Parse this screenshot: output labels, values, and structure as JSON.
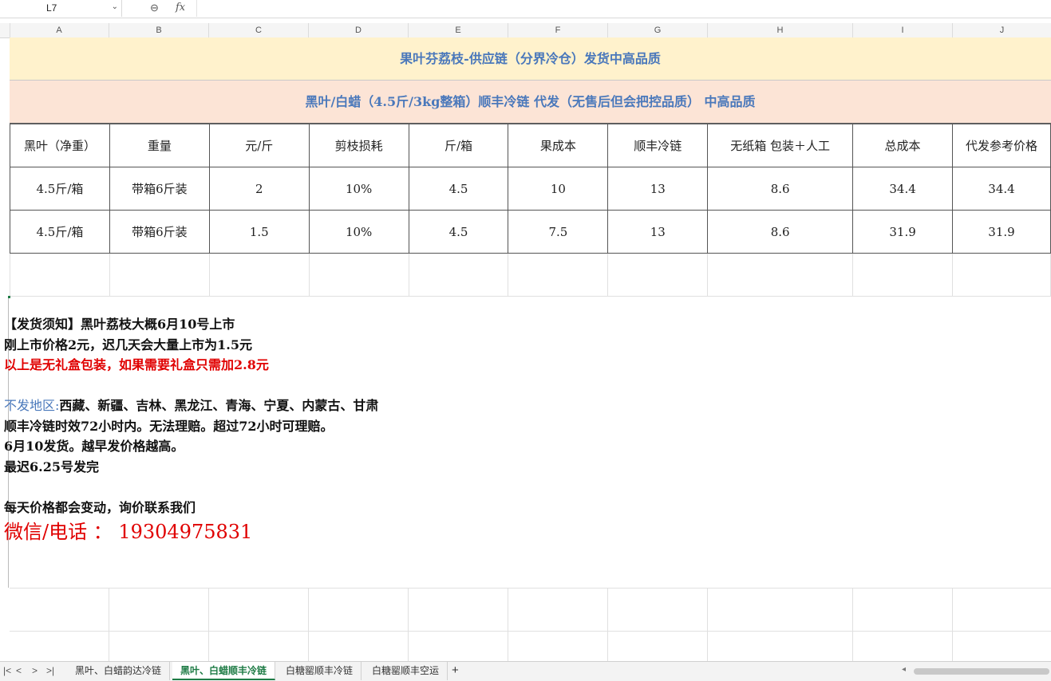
{
  "formula_bar": {
    "cell_ref": "L7",
    "fx": "fx"
  },
  "columns": [
    "A",
    "B",
    "C",
    "D",
    "E",
    "F",
    "G",
    "H",
    "I",
    "J"
  ],
  "title_row": "果叶芬荔枝-供应链（分界冷仓）发货中高品质",
  "subtitle_row": "黑叶/白蜡（4.5斤/3kg整箱）顺丰冷链  代发（无售后但会把控品质）  中高品质",
  "table": {
    "headers": [
      "黑叶（净重）",
      "重量",
      "元/斤",
      "剪枝损耗",
      "斤/箱",
      "果成本",
      "顺丰冷链",
      "无纸箱 包装＋人工",
      "总成本",
      "代发参考价格"
    ],
    "rows": [
      [
        "4.5斤/箱",
        "带箱6斤装",
        "2",
        "10%",
        "4.5",
        "10",
        "13",
        "8.6",
        "34.4",
        "34.4"
      ],
      [
        "4.5斤/箱",
        "带箱6斤装",
        "1.5",
        "10%",
        "4.5",
        "7.5",
        "13",
        "8.6",
        "31.9",
        "31.9"
      ]
    ]
  },
  "notes": {
    "line1": "【发货须知】黑叶荔枝大概6月10号上市",
    "line2": "刚上市价格2元，迟几天会大量上市为1.5元",
    "line3": "以上是无礼盒包装，如果需要礼盒只需加2.8元",
    "line4_label": "不发地区:",
    "line4_text": "西藏、新疆、吉林、黑龙江、青海、宁夏、内蒙古、甘肃",
    "line5": "顺丰冷链时效72小时内。无法理赔。超过72小时可理赔。",
    "line6": "6月10发货。越早发价格越高。",
    "line7": "最迟6.25号发完",
    "line8": "每天价格都会变动，询价联系我们",
    "contact": "微信/电话 ： 19304975831"
  },
  "sheet_tabs": [
    "黑叶、白蜡韵达冷链",
    "黑叶、白蜡顺丰冷链",
    "白糖罂顺丰冷链",
    "白糖罂顺丰空运"
  ],
  "active_tab": 1,
  "colors": {
    "title_bg": "#fff2cc",
    "subtitle_bg": "#fce4d6",
    "header_text": "#4a78bb",
    "alert_red": "#e00000",
    "tab_active": "#1e7b45"
  }
}
